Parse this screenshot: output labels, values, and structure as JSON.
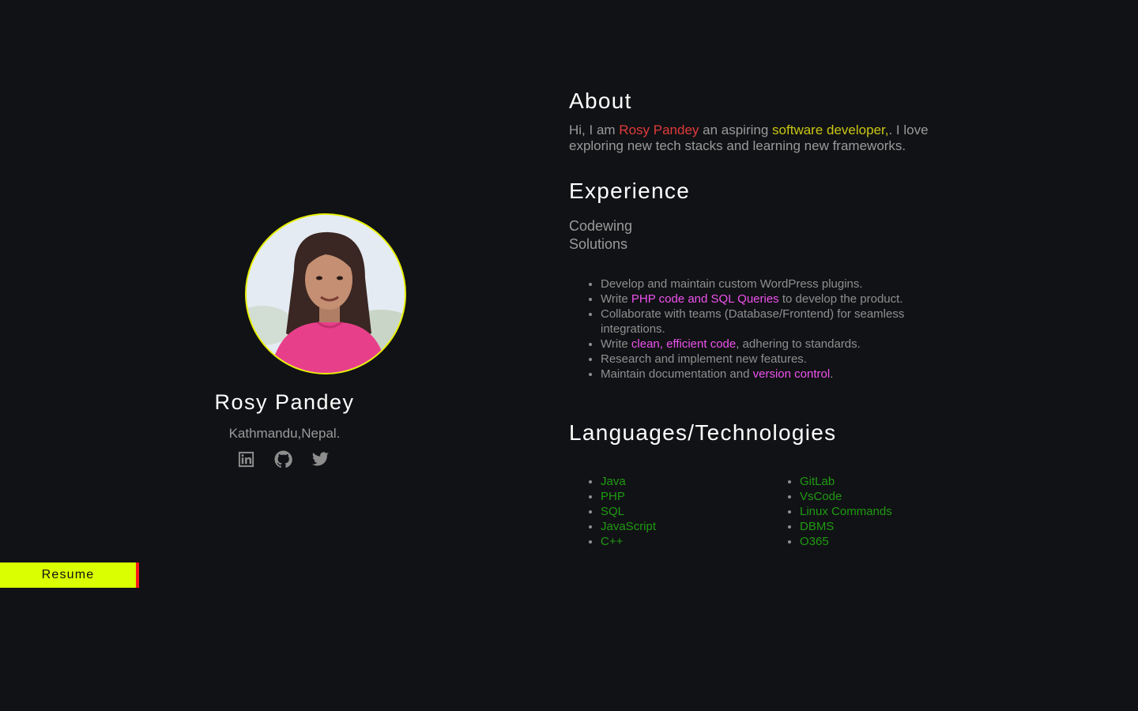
{
  "profile": {
    "name": "Rosy Pandey",
    "location": "Kathmandu,Nepal.",
    "social_icons": [
      "linkedin-icon",
      "github-icon",
      "twitter-icon"
    ],
    "accent_border": "#e8f000"
  },
  "resume_button": {
    "label": "Resume",
    "bg": "#d9ff00",
    "edge": "#ff1a1a"
  },
  "about": {
    "heading": "About",
    "text_before": "Hi, I am ",
    "name_highlight": "Rosy Pandey",
    "text_mid": " an aspiring ",
    "role_highlight": "software developer,",
    "text_after": ". I love exploring new tech stacks and learning new frameworks."
  },
  "experience": {
    "heading": "Experience",
    "company": "Codewing Solutions",
    "duties": {
      "d1": "Develop and maintain custom WordPress plugins.",
      "d2_pre": "Write ",
      "d2_hl": "PHP code and SQL Queries",
      "d2_post": " to develop the product.",
      "d3": "Collaborate with teams (Database/Frontend) for seamless integrations.",
      "d4_pre": "Write ",
      "d4_hl": "clean, efficient code",
      "d4_post": ", adhering to standards.",
      "d5": "Research and implement new features.",
      "d6_pre": "Maintain documentation and ",
      "d6_hl": "version control",
      "d6_post": "."
    }
  },
  "technologies": {
    "heading": "Languages/Technologies",
    "languages": [
      "Java",
      "PHP",
      "SQL",
      "JavaScript",
      "C++"
    ],
    "tools": [
      "GitLab",
      "VsCode",
      "Linux Commands",
      "DBMS",
      "O365"
    ]
  },
  "colors": {
    "background": "#111215",
    "highlight_name": "#e03b3b",
    "highlight_role": "#c9c614",
    "highlight_skill": "#ee52ee",
    "tech_green": "#1f9a12"
  }
}
